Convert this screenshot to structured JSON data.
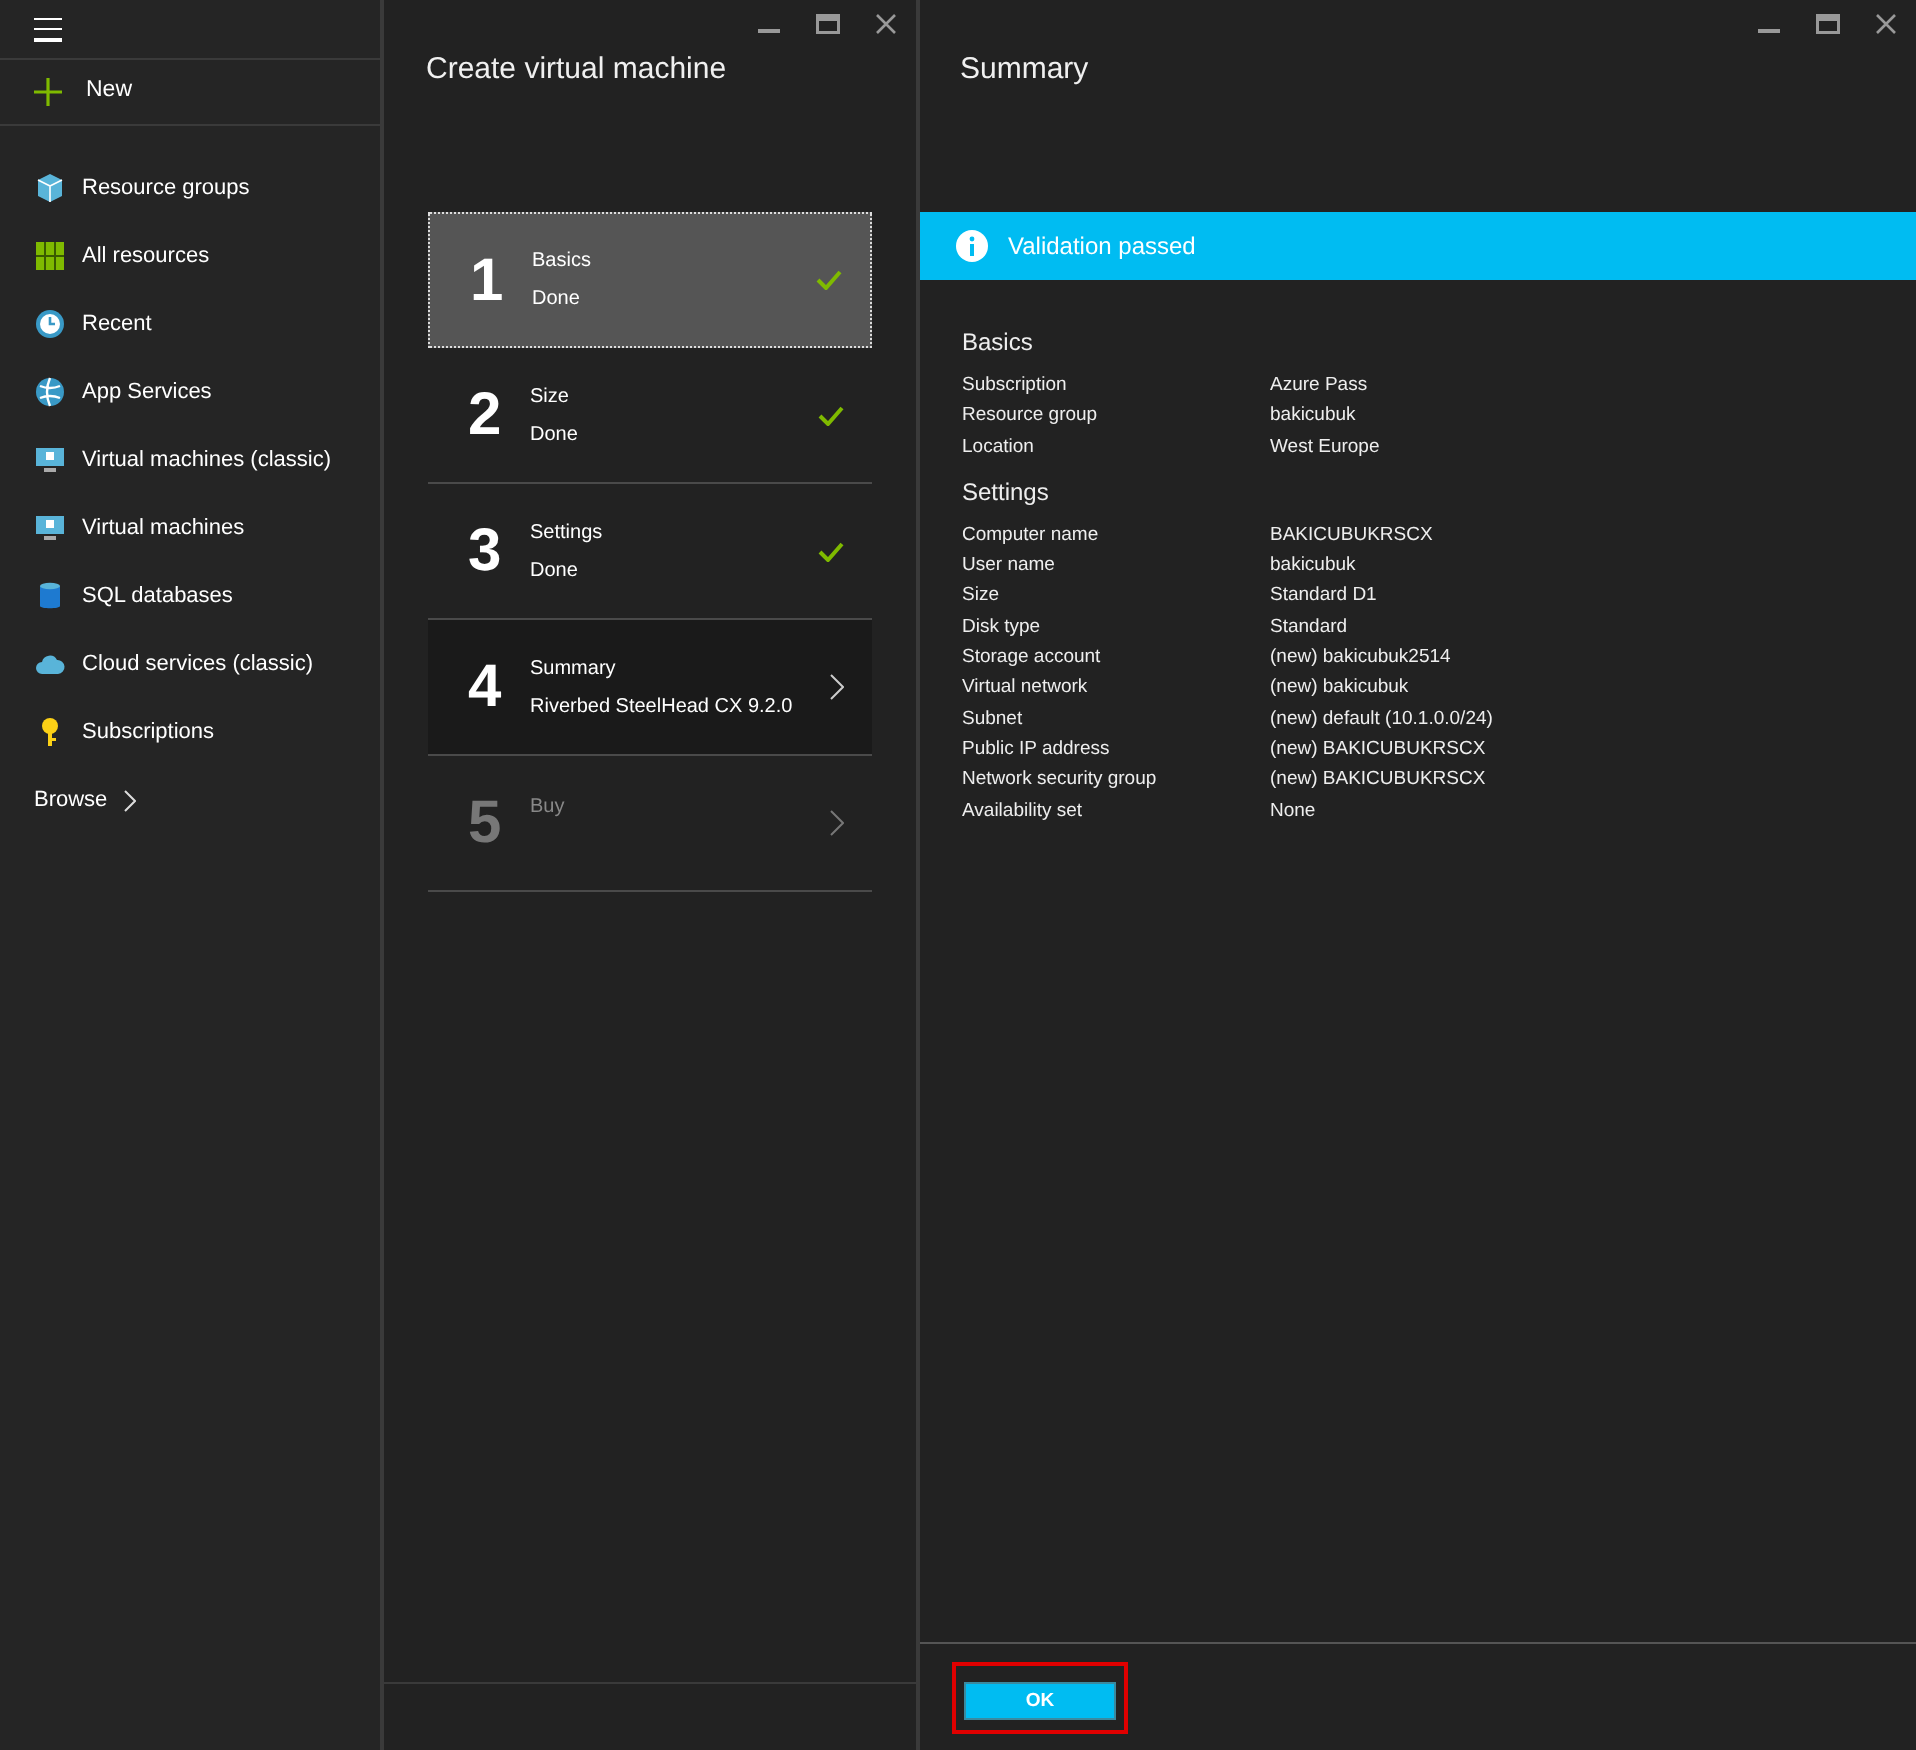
{
  "sidebar": {
    "new_label": "New",
    "items": [
      {
        "label": "Resource groups"
      },
      {
        "label": "All resources"
      },
      {
        "label": "Recent"
      },
      {
        "label": "App Services"
      },
      {
        "label": "Virtual machines (classic)"
      },
      {
        "label": "Virtual machines"
      },
      {
        "label": "SQL databases"
      },
      {
        "label": "Cloud services (classic)"
      },
      {
        "label": "Subscriptions"
      }
    ],
    "browse_label": "Browse"
  },
  "wizard": {
    "title": "Create virtual machine",
    "steps": [
      {
        "number": "1",
        "title": "Basics",
        "subtitle": "Done",
        "kind": "done",
        "selected": true
      },
      {
        "number": "2",
        "title": "Size",
        "subtitle": "Done",
        "kind": "done",
        "selected": false
      },
      {
        "number": "3",
        "title": "Settings",
        "subtitle": "Done",
        "kind": "done",
        "selected": false
      },
      {
        "number": "4",
        "title": "Summary",
        "subtitle": "Riverbed SteelHead CX 9.2.0",
        "kind": "current",
        "selected": false
      },
      {
        "number": "5",
        "title": "Buy",
        "kind": "locked",
        "selected": false
      }
    ]
  },
  "summary": {
    "title": "Summary",
    "banner": "Validation passed",
    "sections": [
      {
        "heading": "Basics",
        "rows": [
          {
            "label": "Subscription",
            "value": "Azure Pass"
          },
          {
            "label": "Resource group",
            "value": "bakicubuk"
          },
          {
            "label": "Location",
            "value": "West Europe"
          }
        ]
      },
      {
        "heading": "Settings",
        "rows": [
          {
            "label": "Computer name",
            "value": "BAKICUBUKRSCX"
          },
          {
            "label": "User name",
            "value": "bakicubuk"
          },
          {
            "label": "Size",
            "value": "Standard D1"
          },
          {
            "label": "Disk type",
            "value": "Standard"
          },
          {
            "label": "Storage account",
            "value": "(new) bakicubuk2514"
          },
          {
            "label": "Virtual network",
            "value": "(new) bakicubuk"
          },
          {
            "label": "Subnet",
            "value": "(new) default (10.1.0.0/24)"
          },
          {
            "label": "Public IP address",
            "value": "(new) BAKICUBUKRSCX"
          },
          {
            "label": "Network security group",
            "value": "(new) BAKICUBUKRSCX"
          },
          {
            "label": "Availability set",
            "value": "None"
          }
        ]
      }
    ],
    "ok_button": "OK",
    "ok_highlighted": true
  }
}
